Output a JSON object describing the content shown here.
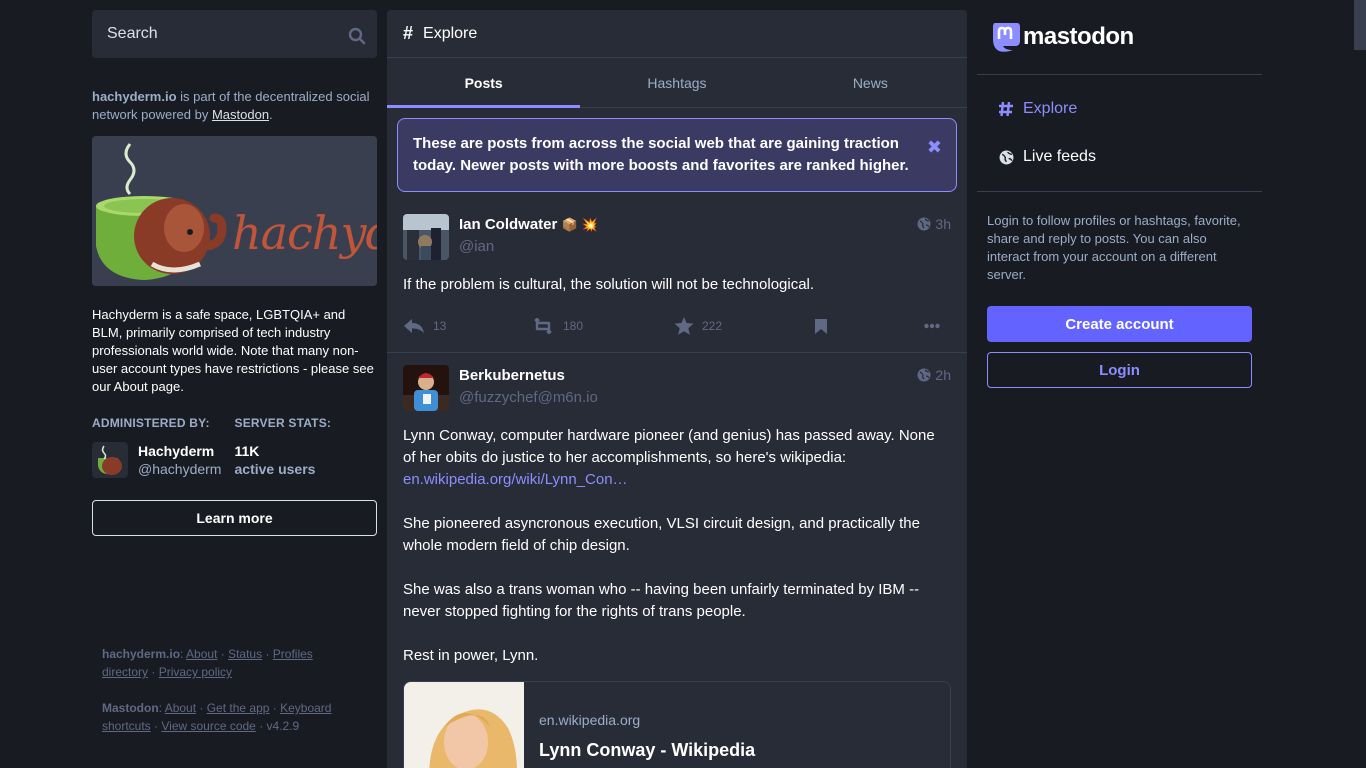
{
  "search": {
    "placeholder": "Search"
  },
  "server_intro": {
    "domain": "hachyderm.io",
    "text": " is part of the decentralized social network powered by ",
    "mastodon_link": "Mastodon",
    "period": "."
  },
  "banner": {
    "logo_text": "hachyderm"
  },
  "about": {
    "text": "Hachyderm is a safe space, LGBTQIA+ and BLM, primarily comprised of tech industry professionals world wide. Note that many non-user account types have restrictions - please see our About page."
  },
  "admin": {
    "heading": "ADMINISTERED BY:",
    "name": "Hachyderm",
    "handle": "@hachyderm"
  },
  "stats": {
    "heading": "SERVER STATS:",
    "value": "11K",
    "label": "active users"
  },
  "learn_more": "Learn more",
  "footer": {
    "server_label": "hachyderm.io",
    "server_links": [
      "About",
      "Status",
      "Profiles directory",
      "Privacy policy"
    ],
    "mastodon_label": "Mastodon",
    "mastodon_links": [
      "About",
      "Get the app",
      "Keyboard shortcuts",
      "View source code"
    ],
    "version": "v4.2.9"
  },
  "header": {
    "icon": "#",
    "title": "Explore"
  },
  "tabs": [
    {
      "label": "Posts",
      "active": true
    },
    {
      "label": "Hashtags",
      "active": false
    },
    {
      "label": "News",
      "active": false
    }
  ],
  "notice": {
    "text": "These are posts from across the social web that are gaining traction today. Newer posts with more boosts and favorites are ranked higher."
  },
  "posts": [
    {
      "display_name": "Ian Coldwater",
      "emoji": "📦 💥",
      "acct": "@ian",
      "time": "3h",
      "content": "If the problem is cultural, the solution will not be technological.",
      "replies": "13",
      "boosts": "180",
      "favorites": "222"
    },
    {
      "display_name": "Berkubernetus",
      "acct": "@fuzzychef@m6n.io",
      "time": "2h",
      "content_1": "Lynn Conway, computer hardware pioneer (and genius) has passed away.  None of her obits do justice to her accomplishments, so here's wikipedia:",
      "link": "en.wikipedia.org/wiki/Lynn_Con…",
      "content_2": "She pioneered asyncronous execution, VLSI circuit design, and practically the whole modern field of chip design.",
      "content_3": "She was also a trans woman who -- having been unfairly terminated by IBM -- never stopped fighting for the rights of trans people.",
      "content_4": "Rest in power, Lynn.",
      "card": {
        "provider": "en.wikipedia.org",
        "title": "Lynn Conway - Wikipedia"
      }
    }
  ],
  "brand": {
    "name": "mastodon"
  },
  "nav": [
    {
      "label": "Explore",
      "icon": "hashtag-icon",
      "active": true
    },
    {
      "label": "Live feeds",
      "icon": "globe-icon",
      "active": false
    }
  ],
  "signin": {
    "text": "Login to follow profiles or hashtags, favorite, share and reply to posts. You can also interact from your account on a different server.",
    "create_account": "Create account",
    "login": "Login"
  },
  "colors": {
    "background": "#191b22",
    "panel": "#282c37",
    "accent": "#8c8dff",
    "primary_button": "#6364ff",
    "muted": "#9baec8"
  }
}
